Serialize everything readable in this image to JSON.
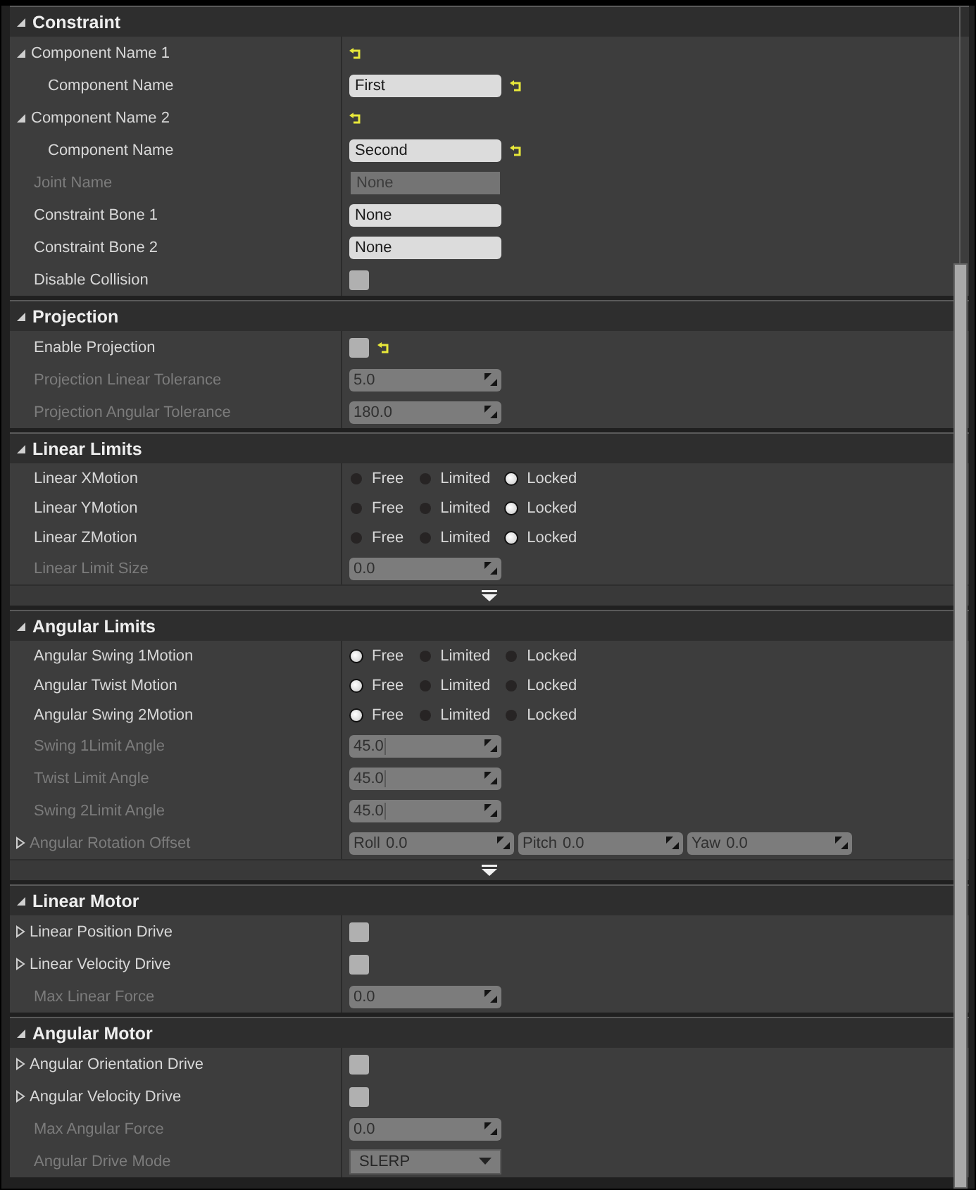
{
  "sections": [
    {
      "title": "Constraint",
      "expanded": true,
      "rows": [
        {
          "kind": "group",
          "label": "Component Name 1",
          "expanded": true,
          "resettable": true,
          "children": [
            {
              "kind": "text",
              "label": "Component Name",
              "value": "First",
              "resettable": true
            }
          ]
        },
        {
          "kind": "group",
          "label": "Component Name 2",
          "expanded": true,
          "resettable": true,
          "children": [
            {
              "kind": "text",
              "label": "Component Name",
              "value": "Second",
              "resettable": true
            }
          ]
        },
        {
          "kind": "text",
          "label": "Joint Name",
          "value": "None",
          "disabled": true
        },
        {
          "kind": "text",
          "label": "Constraint Bone 1",
          "value": "None"
        },
        {
          "kind": "text",
          "label": "Constraint Bone 2",
          "value": "None"
        },
        {
          "kind": "checkbox",
          "label": "Disable Collision",
          "checked": false
        }
      ]
    },
    {
      "title": "Projection",
      "expanded": true,
      "rows": [
        {
          "kind": "checkbox",
          "label": "Enable Projection",
          "checked": false,
          "resettable": true
        },
        {
          "kind": "number",
          "label": "Projection Linear Tolerance",
          "value": "5.0",
          "disabled": true
        },
        {
          "kind": "number",
          "label": "Projection Angular Tolerance",
          "value": "180.0",
          "disabled": true
        }
      ]
    },
    {
      "title": "Linear Limits",
      "expanded": true,
      "more": true,
      "rows": [
        {
          "kind": "radio",
          "label": "Linear XMotion",
          "options": [
            {
              "label": "Free",
              "selected": false
            },
            {
              "label": "Limited",
              "selected": false
            },
            {
              "label": "Locked",
              "selected": true
            }
          ]
        },
        {
          "kind": "radio",
          "label": "Linear YMotion",
          "options": [
            {
              "label": "Free",
              "selected": false
            },
            {
              "label": "Limited",
              "selected": false
            },
            {
              "label": "Locked",
              "selected": true
            }
          ]
        },
        {
          "kind": "radio",
          "label": "Linear ZMotion",
          "options": [
            {
              "label": "Free",
              "selected": false
            },
            {
              "label": "Limited",
              "selected": false
            },
            {
              "label": "Locked",
              "selected": true
            }
          ]
        },
        {
          "kind": "number",
          "label": "Linear Limit Size",
          "value": "0.0",
          "disabled": true
        }
      ]
    },
    {
      "title": "Angular Limits",
      "expanded": true,
      "more": true,
      "rows": [
        {
          "kind": "radio",
          "label": "Angular Swing 1Motion",
          "options": [
            {
              "label": "Free",
              "selected": true
            },
            {
              "label": "Limited",
              "selected": false
            },
            {
              "label": "Locked",
              "selected": false
            }
          ]
        },
        {
          "kind": "radio",
          "label": "Angular Twist Motion",
          "options": [
            {
              "label": "Free",
              "selected": true
            },
            {
              "label": "Limited",
              "selected": false
            },
            {
              "label": "Locked",
              "selected": false
            }
          ]
        },
        {
          "kind": "radio",
          "label": "Angular Swing 2Motion",
          "options": [
            {
              "label": "Free",
              "selected": true
            },
            {
              "label": "Limited",
              "selected": false
            },
            {
              "label": "Locked",
              "selected": false
            }
          ]
        },
        {
          "kind": "number",
          "label": "Swing 1Limit Angle",
          "value": "45.0",
          "disabled": true,
          "split": true
        },
        {
          "kind": "number",
          "label": "Twist Limit Angle",
          "value": "45.0",
          "disabled": true,
          "split": true
        },
        {
          "kind": "number",
          "label": "Swing 2Limit Angle",
          "value": "45.0",
          "disabled": true,
          "split": true
        },
        {
          "kind": "vector",
          "label": "Angular Rotation Offset",
          "expanded": false,
          "disabled": true,
          "components": [
            {
              "label": "Roll",
              "value": "0.0"
            },
            {
              "label": "Pitch",
              "value": "0.0"
            },
            {
              "label": "Yaw",
              "value": "0.0"
            }
          ]
        }
      ]
    },
    {
      "title": "Linear Motor",
      "expanded": true,
      "rows": [
        {
          "kind": "checkbox",
          "label": "Linear Position Drive",
          "expanded": false,
          "checked": false
        },
        {
          "kind": "checkbox",
          "label": "Linear Velocity Drive",
          "expanded": false,
          "checked": false
        },
        {
          "kind": "number",
          "label": "Max Linear Force",
          "value": "0.0",
          "disabled": true
        }
      ]
    },
    {
      "title": "Angular Motor",
      "expanded": true,
      "rows": [
        {
          "kind": "checkbox",
          "label": "Angular Orientation Drive",
          "expanded": false,
          "checked": false
        },
        {
          "kind": "checkbox",
          "label": "Angular Velocity Drive",
          "expanded": false,
          "checked": false
        },
        {
          "kind": "number",
          "label": "Max Angular Force",
          "value": "0.0",
          "disabled": true
        },
        {
          "kind": "dropdown",
          "label": "Angular Drive Mode",
          "value": "SLERP",
          "disabled": true
        }
      ]
    }
  ]
}
